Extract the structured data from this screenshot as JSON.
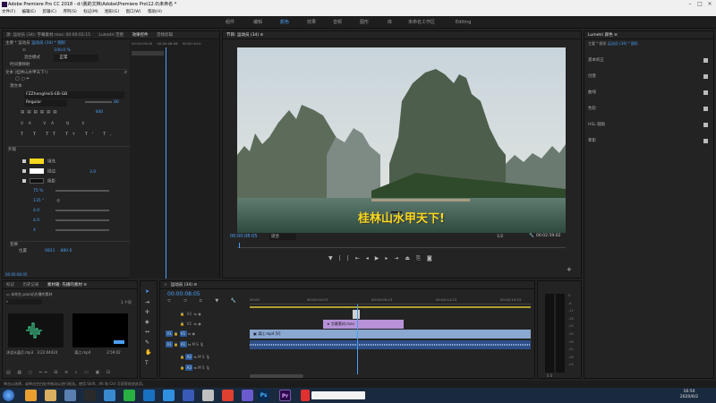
{
  "window": {
    "title": "Adobe Premiere Pro CC 2018 - d:\\我的文档\\Adobe\\Premiere Pro\\12.0\\未命名 *",
    "menu": [
      "文件(F)",
      "编辑(E)",
      "剪辑(C)",
      "序列(S)",
      "标记(M)",
      "图形(G)",
      "窗口(W)",
      "帮助(H)"
    ]
  },
  "workspaces": {
    "tabs": [
      "组件",
      "编辑",
      "颜色",
      "效果",
      "音频",
      "图形",
      "库",
      "未命名工作区",
      "Editing"
    ],
    "active_index": 2
  },
  "effect_controls": {
    "tabs": [
      "源: 运动员 (34): 字幕素材.mov: 00:00:02:15",
      "Lumetri 范围",
      "效果控件",
      "音频剪辑"
    ],
    "active_tab": "效果控件",
    "path_left": "主要 * 运动员",
    "path_right": "运动员 (34) * 图形",
    "timecode_a": "00:00:05:00",
    "timecode_b": "00:00:08:06",
    "timecode_c": "00:00:10:0",
    "motion_opacity_value": "100.0 %",
    "blend_label": "混合模式",
    "blend_value": "正常",
    "time_remap": "时间重映射",
    "text_layer": "文本 (桂林山水甲天下!)",
    "source_text": "源文本",
    "font": "FZZhengHeiS-EB-GB",
    "font_style": "Regular",
    "font_size": "80",
    "tracking": "400",
    "appearance": "外观",
    "fill_label": "填充",
    "stroke_label": "描边",
    "stroke_value": "3.0",
    "shadow_label": "阴影",
    "opacity_value": "75 %",
    "angle_value": "135 °",
    "distance_value": "4.0",
    "size_value": "4.0",
    "blur_value": "4",
    "transform_label": "变换",
    "position_label": "位置",
    "position_x": "0821",
    "position_y": "880.6",
    "bottom_timecode": "00:00:08:05"
  },
  "program_monitor": {
    "title": "节目: 运动员 (34) ≡",
    "subtitle": "桂林山水甲天下!",
    "timecode": "00:00:08:05",
    "fit_label": "适合",
    "quality": "1/2",
    "duration": "00:02:59:02"
  },
  "lumetri": {
    "tabs": [
      "Lumetri 颜色 ≡"
    ],
    "path": "主要 * 图形",
    "path_right": "运动员 (34) * 图形",
    "sections": [
      {
        "label": "基本校正",
        "checked": true
      },
      {
        "label": "创意",
        "checked": true
      },
      {
        "label": "曲线",
        "checked": true
      },
      {
        "label": "色轮",
        "checked": true
      },
      {
        "label": "HSL 辅助",
        "checked": true
      },
      {
        "label": "晕影",
        "checked": true
      }
    ]
  },
  "project_panel": {
    "tabs": [
      "标记",
      "历史记录",
      "素材箱: 先播的素材 ≡"
    ],
    "active_tab": "素材箱: 先播的素材 ≡",
    "path": "未命名.prproj\\先播的素材",
    "count": "1 个项",
    "items": [
      {
        "name": "沐浴水晶灯.mp3",
        "duration": "3:22:04424"
      },
      {
        "name": "漓江.mp4",
        "duration": "2:59:02"
      }
    ]
  },
  "timeline": {
    "title": "运动员 (34) ≡",
    "timecode": "00:00:08:05",
    "ruler": [
      "00:00",
      "00:00:04:23",
      "00:00:09:23",
      "00:00:14:23",
      "00:00:19:23"
    ],
    "video_tracks": [
      "V3",
      "V2",
      "V1"
    ],
    "audio_tracks": [
      "A1",
      "A2",
      "A3"
    ],
    "clip_graphic": "字幕素材.mov",
    "clip_video": "漓江.mp4 [V]",
    "audio_meter_labels": [
      "0",
      "-6",
      "-12",
      "-18",
      "-24",
      "-30",
      "-36",
      "-42",
      "-48",
      "-54"
    ],
    "meter_footer": "S S"
  },
  "status": {
    "text": "单击以选择，或单击空白处并拖动以进行框选。使用 Shift、Alt 和 Ctrl 可获得其他选项。"
  },
  "taskbar": {
    "time": "16:50",
    "date": "2020/6/2"
  },
  "colors": {
    "accent": "#4a9ff5",
    "subtitle": "#f7d81f",
    "video_clip": "#8aa8d0",
    "graphic_clip": "#b792d8",
    "audio_clip": "#4b6fa8"
  }
}
